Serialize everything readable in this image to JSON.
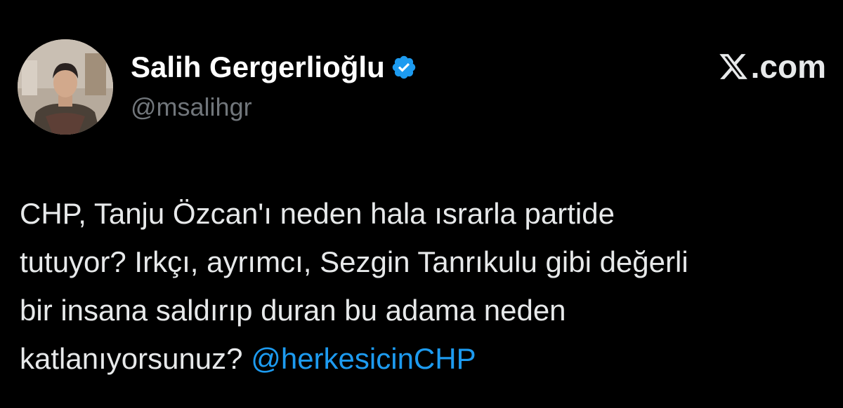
{
  "author": {
    "display_name": "Salih Gergerlioğlu",
    "handle": "@msalihgr",
    "verified": true,
    "verified_badge_icon": "verified-check-icon",
    "avatar_icon": "profile-photo"
  },
  "source": {
    "logo_icon": "x-logo-icon",
    "suffix": ".com"
  },
  "tweet": {
    "lines": [
      "CHP, Tanju Özcan'ı neden hala ısrarla partide",
      "tutuyor? Irkçı, ayrımcı, Sezgin Tanrıkulu gibi değerli",
      "bir insana saldırıp duran bu adama neden"
    ],
    "last_line_text": "katlanıyorsunuz? ",
    "mention": "@herkesicinCHP"
  },
  "colors": {
    "background": "#000000",
    "primary_text": "#e7e9ea",
    "secondary_text": "#71767b",
    "accent": "#1d9bf0"
  }
}
